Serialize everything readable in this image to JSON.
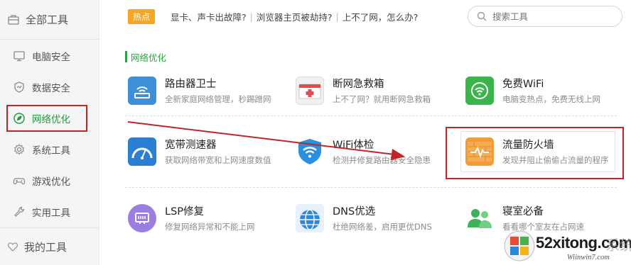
{
  "sidebar": {
    "header": {
      "label": "全部工具",
      "icon": "toolbox-icon"
    },
    "items": [
      {
        "label": "电脑安全",
        "icon": "monitor-icon"
      },
      {
        "label": "数据安全",
        "icon": "shield-icon"
      },
      {
        "label": "网络优化",
        "icon": "network-leaf-icon",
        "active": true
      },
      {
        "label": "系统工具",
        "icon": "gear-icon"
      },
      {
        "label": "游戏优化",
        "icon": "gamepad-icon"
      },
      {
        "label": "实用工具",
        "icon": "wrench-icon"
      }
    ],
    "footer": {
      "label": "我的工具",
      "icon": "heart-icon"
    }
  },
  "topbar": {
    "hot_badge": "热点",
    "hot_links": [
      "显卡、声卡出故障?",
      "浏览器主页被劫持?",
      "上不了网，怎么办?"
    ],
    "search_placeholder": "搜索工具"
  },
  "section": {
    "title": "网络优化"
  },
  "tools": [
    {
      "name": "路由器卫士",
      "desc": "全新家庭网络管理，秒踢蹭网",
      "icon": "router-icon",
      "color": "#3d8fd8"
    },
    {
      "name": "断网急救箱",
      "desc": "上不了网？就用断网急救箱",
      "icon": "first-aid-kit-icon",
      "color": "#e84a4a"
    },
    {
      "name": "免费WiFi",
      "desc": "电脑变热点，免费无线上网",
      "icon": "wifi-icon",
      "color": "#3bb54a"
    },
    {
      "name": "宽带测速器",
      "desc": "获取网络带宽和上网速度数值",
      "icon": "speedometer-icon",
      "color": "#2a7fd4"
    },
    {
      "name": "WiFi体检",
      "desc": "检测并修复路由器安全隐患",
      "icon": "wifi-shield-icon",
      "color": "#2c8fe0"
    },
    {
      "name": "流量防火墙",
      "desc": "发现并阻止偷偷占流量的程序",
      "icon": "firewall-icon",
      "color": "#f39b38"
    },
    {
      "name": "LSP修复",
      "desc": "修复网络异常和不能上网",
      "icon": "lsp-icon",
      "color": "#9b7fe0"
    },
    {
      "name": "DNS优选",
      "desc": "杜绝网络差，启用更优DNS",
      "icon": "globe-icon",
      "color": "#2d86d6"
    },
    {
      "name": "寝室必备",
      "desc": "看看哪个室友在占网速",
      "icon": "users-icon",
      "color": "#3cb25a"
    }
  ],
  "watermark": {
    "main": "52xitong.com",
    "sub": "Wiinwin7.com",
    "cn": "系统家"
  }
}
